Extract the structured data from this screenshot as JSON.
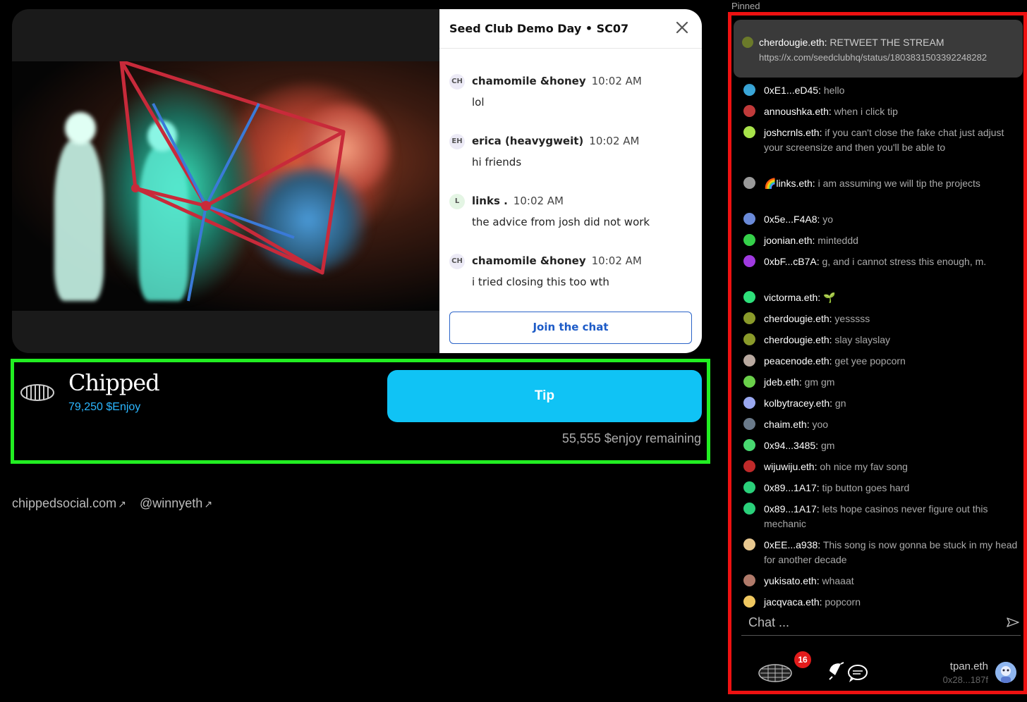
{
  "overlay": {
    "title": "Seed Club Demo Day • SC07",
    "messages": [
      {
        "initials": "CH",
        "name": "chamomile &honey",
        "time": "10:02 AM",
        "text": "lol"
      },
      {
        "initials": "EH",
        "name": "erica (heavygweit)",
        "time": "10:02 AM",
        "text": "hi friends"
      },
      {
        "initials": "L",
        "name": "links .",
        "time": "10:02 AM",
        "text": "the advice from josh did not work"
      },
      {
        "initials": "CH",
        "name": "chamomile &honey",
        "time": "10:02 AM",
        "text": "i tried closing this too wth"
      }
    ],
    "join_label": "Join the chat"
  },
  "project": {
    "name": "Chipped",
    "balance": "79,250 $Enjoy",
    "tip_label": "Tip",
    "remaining": "55,555 $enjoy remaining"
  },
  "links": [
    {
      "label": "chippedsocial.com",
      "arrow": "↗"
    },
    {
      "label": "@winnyeth",
      "arrow": "↗"
    }
  ],
  "chat": {
    "pinned_label": "Pinned",
    "pinned": {
      "user": "cherdougie.eth:",
      "text": "RETWEET THE STREAM",
      "link": "https://x.com/seedclubhq/status/1803831503392248282"
    },
    "messages": [
      {
        "user": "0xE1...eD45:",
        "text": "hello",
        "color": "#3aa6d8"
      },
      {
        "user": "annoushka.eth:",
        "text": "when i click tip",
        "color": "#c03a3a"
      },
      {
        "user": "joshcrnls.eth:",
        "text": "if you can't close the fake chat just adjust your screensize and then you'll be able to",
        "color": "#a8e34a"
      },
      {
        "user": "🌈links.eth:",
        "text": "i am assuming we will tip the projects",
        "color": "#9a9a9a"
      },
      {
        "user": "0x5e...F4A8:",
        "text": "yo",
        "color": "#6a8ad8"
      },
      {
        "user": "joonian.eth:",
        "text": "minteddd",
        "color": "#35d04a"
      },
      {
        "user": "0xbF...cB7A:",
        "text": "g, and i cannot stress this enough, m.",
        "color": "#a03ae0"
      },
      {
        "user": "victorma.eth:",
        "text": "🌱",
        "color": "#2ee07a"
      },
      {
        "user": "cherdougie.eth:",
        "text": "yesssss",
        "color": "#8a9a2a"
      },
      {
        "user": "cherdougie.eth:",
        "text": "slay slayslay",
        "color": "#8a9a2a"
      },
      {
        "user": "peacenode.eth:",
        "text": "get yee popcorn",
        "color": "#b9a9a0"
      },
      {
        "user": "jdeb.eth:",
        "text": "gm gm",
        "color": "#6ad04a"
      },
      {
        "user": "kolbytracey.eth:",
        "text": "gn",
        "color": "#9aa8f0"
      },
      {
        "user": "chaim.eth:",
        "text": "yoo",
        "color": "#6a7a8a"
      },
      {
        "user": "0x94...3485:",
        "text": "gm",
        "color": "#48d870"
      },
      {
        "user": "wijuwiju.eth:",
        "text": "oh nice my fav song",
        "color": "#c02a2a"
      },
      {
        "user": "0x89...1A17:",
        "text": "tip button goes hard",
        "color": "#2ad07a"
      },
      {
        "user": "0x89...1A17:",
        "text": "lets hope casinos never figure out this mechanic",
        "color": "#2ad07a"
      },
      {
        "user": "0xEE...a938:",
        "text": "This song is now gonna be stuck in my head for another decade",
        "color": "#e8c890"
      },
      {
        "user": "yukisato.eth:",
        "text": "whaaat",
        "color": "#b07a6a"
      },
      {
        "user": "jacqvaca.eth:",
        "text": "popcorn",
        "color": "#f0c860"
      }
    ],
    "input_placeholder": "Chat ...",
    "badge_count": "16",
    "username": "tpan.eth",
    "address": "0x28...187f"
  }
}
